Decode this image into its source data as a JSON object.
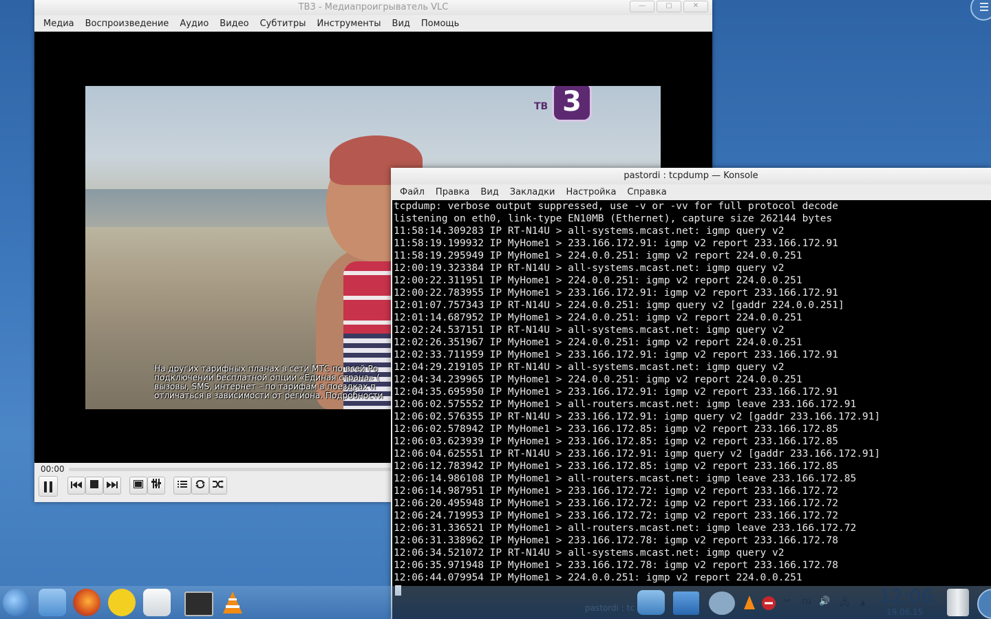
{
  "vlc": {
    "title": "ТВ3 - Медиапроигрыватель VLC",
    "menu": [
      "Медиа",
      "Воспроизведение",
      "Аудио",
      "Видео",
      "Субтитры",
      "Инструменты",
      "Вид",
      "Помощь"
    ],
    "time": "00:00",
    "video": {
      "channel_logo_text": "ТВ",
      "channel_logo_number": "3",
      "subtitles": [
        "На других тарифных планах в сети МТС по всей Ро",
        "подключении бесплатной опции «Единая страна» (",
        "вызовы, SMS, интернет – по тарифам в поездках п",
        "отличаться в зависимости от региона. Подробности"
      ]
    },
    "controls": {
      "pause_icon": "pause-icon",
      "prev_icon": "skip-previous-icon",
      "stop_icon": "stop-icon",
      "next_icon": "skip-next-icon",
      "fullscreen_icon": "fullscreen-icon",
      "equalizer_icon": "equalizer-icon",
      "playlist_icon": "playlist-icon",
      "loop_icon": "loop-icon",
      "shuffle_icon": "shuffle-icon"
    }
  },
  "konsole": {
    "title": "pastordi : tcpdump — Konsole",
    "menu": [
      "Файл",
      "Правка",
      "Вид",
      "Закладки",
      "Настройка",
      "Справка"
    ],
    "lines": [
      "tcpdump: verbose output suppressed, use -v or -vv for full protocol decode",
      "listening on eth0, link-type EN10MB (Ethernet), capture size 262144 bytes",
      "11:58:14.309283 IP RT-N14U > all-systems.mcast.net: igmp query v2",
      "11:58:19.199932 IP MyHome1 > 233.166.172.91: igmp v2 report 233.166.172.91",
      "11:58:19.295949 IP MyHome1 > 224.0.0.251: igmp v2 report 224.0.0.251",
      "12:00:19.323384 IP RT-N14U > all-systems.mcast.net: igmp query v2",
      "12:00:22.311951 IP MyHome1 > 224.0.0.251: igmp v2 report 224.0.0.251",
      "12:00:22.783955 IP MyHome1 > 233.166.172.91: igmp v2 report 233.166.172.91",
      "12:01:07.757343 IP RT-N14U > 224.0.0.251: igmp query v2 [gaddr 224.0.0.251]",
      "12:01:14.687952 IP MyHome1 > 224.0.0.251: igmp v2 report 224.0.0.251",
      "12:02:24.537151 IP RT-N14U > all-systems.mcast.net: igmp query v2",
      "12:02:26.351967 IP MyHome1 > 224.0.0.251: igmp v2 report 224.0.0.251",
      "12:02:33.711959 IP MyHome1 > 233.166.172.91: igmp v2 report 233.166.172.91",
      "12:04:29.219105 IP RT-N14U > all-systems.mcast.net: igmp query v2",
      "12:04:34.239965 IP MyHome1 > 224.0.0.251: igmp v2 report 224.0.0.251",
      "12:04:35.695950 IP MyHome1 > 233.166.172.91: igmp v2 report 233.166.172.91",
      "12:06:02.575552 IP MyHome1 > all-routers.mcast.net: igmp leave 233.166.172.91",
      "12:06:02.576355 IP RT-N14U > 233.166.172.91: igmp query v2 [gaddr 233.166.172.91]",
      "12:06:02.578942 IP MyHome1 > 233.166.172.85: igmp v2 report 233.166.172.85",
      "12:06:03.623939 IP MyHome1 > 233.166.172.85: igmp v2 report 233.166.172.85",
      "12:06:04.625551 IP RT-N14U > 233.166.172.91: igmp query v2 [gaddr 233.166.172.91]",
      "12:06:12.783942 IP MyHome1 > 233.166.172.85: igmp v2 report 233.166.172.85",
      "12:06:14.986108 IP MyHome1 > all-routers.mcast.net: igmp leave 233.166.172.85",
      "12:06:14.987951 IP MyHome1 > 233.166.172.72: igmp v2 report 233.166.172.72",
      "12:06:20.495948 IP MyHome1 > 233.166.172.72: igmp v2 report 233.166.172.72",
      "12:06:24.719953 IP MyHome1 > 233.166.172.72: igmp v2 report 233.166.172.72",
      "12:06:31.336521 IP MyHome1 > all-routers.mcast.net: igmp leave 233.166.172.72",
      "12:06:31.338962 IP MyHome1 > 233.166.172.78: igmp v2 report 233.166.172.78",
      "12:06:34.521072 IP RT-N14U > all-systems.mcast.net: igmp query v2",
      "12:06:35.971948 IP MyHome1 > 233.166.172.78: igmp v2 report 233.166.172.78",
      "12:06:44.079954 IP MyHome1 > 224.0.0.251: igmp v2 report 224.0.0.251"
    ]
  },
  "taskbar": {
    "launchers": [
      {
        "name": "kde-menu-icon",
        "color": "#3b86d6"
      },
      {
        "name": "file-manager-icon",
        "color": "#6aa7e0"
      },
      {
        "name": "firefox-icon",
        "color": "#e8681e"
      },
      {
        "name": "chat-icon",
        "color": "#f3cf22"
      },
      {
        "name": "mail-icon",
        "color": "#e2e6ea"
      },
      {
        "name": "terminal-icon",
        "color": "#2d2d2d"
      },
      {
        "name": "vlc-icon",
        "color": "#f28a13"
      }
    ],
    "task_label": "pastordi : tc",
    "tray": {
      "language": "ru",
      "lang_label": "ru"
    },
    "clock": "12:06",
    "date": "19.06.15"
  },
  "colors": {
    "desktop": "#3e79bd",
    "terminal_bg": "#000000",
    "terminal_fg": "#e8e8e8",
    "vlc_logo_purple": "#5d2a72"
  }
}
